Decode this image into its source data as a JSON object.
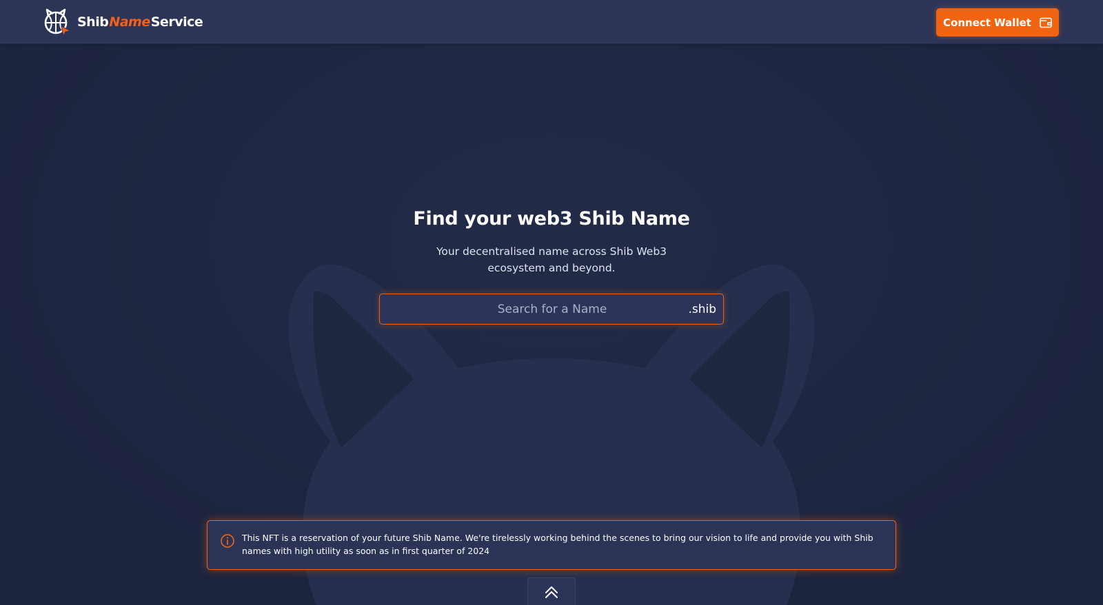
{
  "header": {
    "logo": {
      "word1": "Shib",
      "word2": "Name",
      "word3": "Service",
      "icon": "shib-logo-icon"
    },
    "connect_wallet": {
      "label": "Connect Wallet",
      "icon": "wallet-icon"
    }
  },
  "hero": {
    "title": "Find your web3 Shib Name",
    "subtitle": "Your decentralised name across Shib Web3 ecosystem and beyond."
  },
  "search": {
    "placeholder": "Search for a Name",
    "value": "",
    "suffix": ".shib"
  },
  "notice": {
    "icon": "info-icon",
    "text": "This NFT is a reservation of your future Shib Name. We're tirelessly working behind the scenes to bring our vision to life and provide you with Shib names with high utility as soon as in first quarter of 2024"
  },
  "scroll_top": {
    "icon": "double-chevron-up-icon"
  },
  "colors": {
    "accent": "#f16512",
    "header_bg": "#2c3558",
    "page_bg": "#1f2640",
    "panel_bg": "#2b3457"
  }
}
